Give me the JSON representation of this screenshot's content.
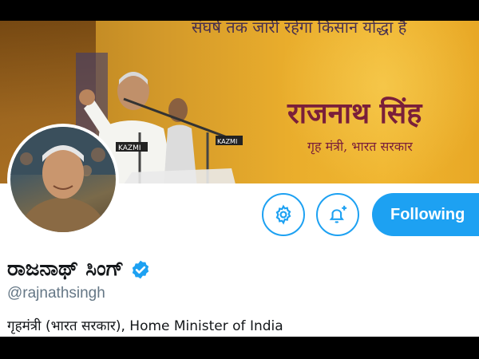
{
  "banner": {
    "top_text": "संघर्ष तक जारी रहेगा किसान योद्धा है",
    "name_text": "राजनाथ सिंह",
    "subtitle_text": "गृह मंत्री, भारत सरकार",
    "mic_label_left": "KAZMI",
    "mic_label_right": "KAZMI"
  },
  "profile": {
    "display_name": "ರಾಜನಾಥ್ ಸಿಂಗ್",
    "handle": "@rajnathsingh",
    "bio": "गृहमंत्री (भारत सरकार), Home Minister of India",
    "verified": true
  },
  "actions": {
    "settings_icon": "gear-icon",
    "notify_icon": "bell-plus-icon",
    "follow_label": "Following"
  },
  "colors": {
    "accent": "#1da1f2",
    "text": "#14171a",
    "secondary": "#657786"
  }
}
